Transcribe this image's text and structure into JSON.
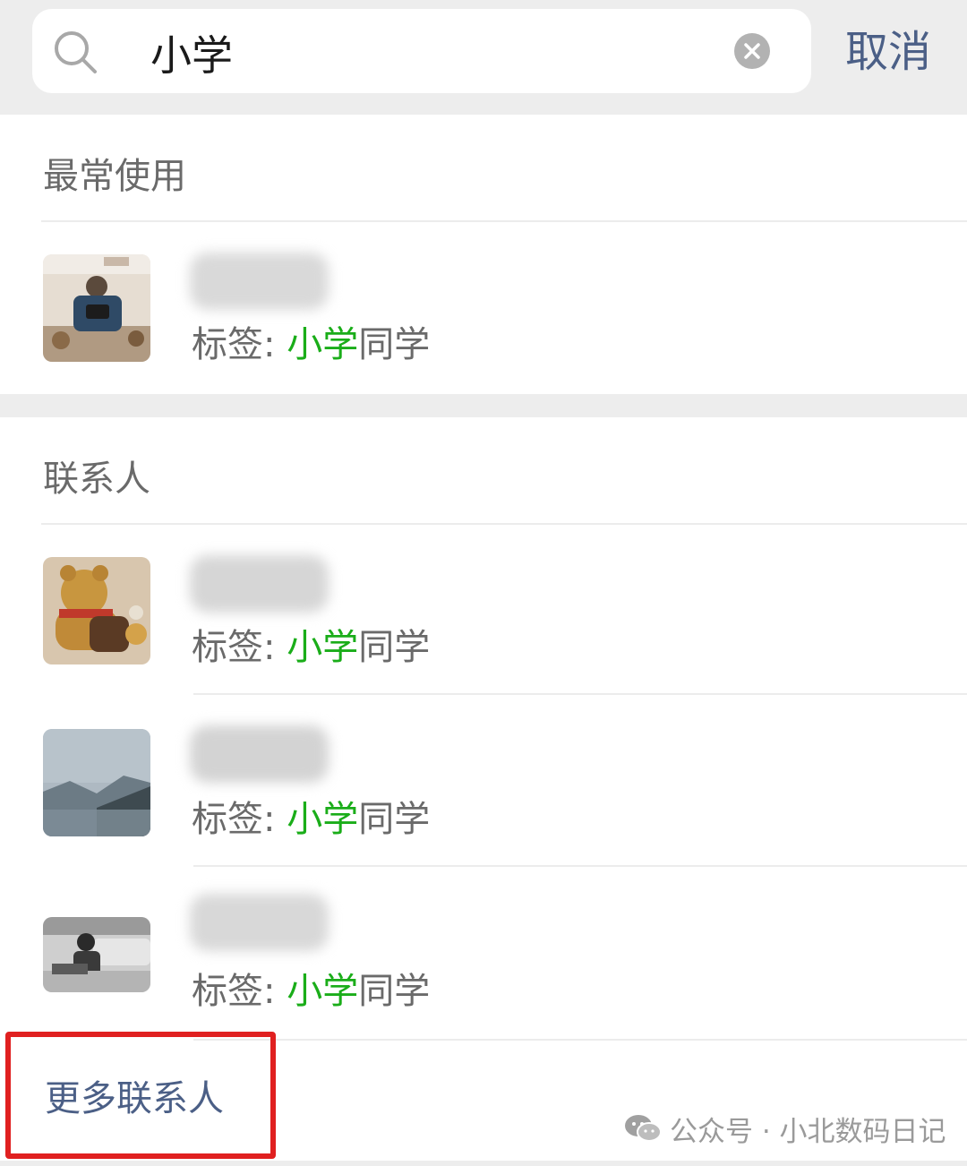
{
  "search": {
    "query": "小学",
    "cancel_label": "取消"
  },
  "sections": {
    "frequent": {
      "title": "最常使用",
      "items": [
        {
          "tag_prefix": "标签: ",
          "tag_match": "小学",
          "tag_rest": "同学"
        }
      ]
    },
    "contacts": {
      "title": "联系人",
      "items": [
        {
          "tag_prefix": "标签: ",
          "tag_match": "小学",
          "tag_rest": "同学"
        },
        {
          "tag_prefix": "标签: ",
          "tag_match": "小学",
          "tag_rest": "同学"
        },
        {
          "tag_prefix": "标签: ",
          "tag_match": "小学",
          "tag_rest": "同学"
        }
      ],
      "more_label": "更多联系人"
    }
  },
  "watermark": {
    "text": "公众号 · 小北数码日记"
  },
  "colors": {
    "highlight_match": "#1aad19",
    "link_blue": "#4b5f86",
    "annotation_red": "#e02020"
  }
}
